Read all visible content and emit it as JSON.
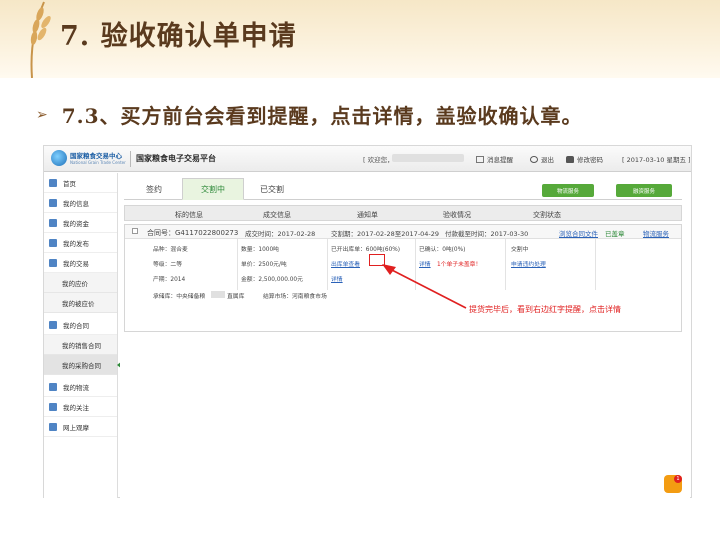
{
  "slide": {
    "title": "7. 验收确认单申请",
    "bullet": "➢",
    "subtitle": "7.3、买方前台会看到提醒，点击详情，盖验收确认章。"
  },
  "topbar": {
    "logo_main": "国家粮食交易中心",
    "logo_en": "National Grain Trade Center",
    "platform_title": "国家粮食电子交易平台",
    "welcome": "[ 欢迎您，",
    "message": "消息提醒",
    "logout": "退出",
    "change_password": "修改密码",
    "date": "[ 2017-03-10 星期五 ]"
  },
  "sidebar": {
    "items": [
      {
        "label": "首页",
        "icon": "home-icon"
      },
      {
        "label": "我的信息",
        "icon": "user-icon"
      },
      {
        "label": "我的资金",
        "icon": "money-icon"
      },
      {
        "label": "我的发布",
        "icon": "publish-icon"
      },
      {
        "label": "我的交易",
        "icon": "trade-icon"
      }
    ],
    "trade_subs": [
      "我的应价",
      "我的被应价"
    ],
    "contract": {
      "label": "我的合同",
      "icon": "contract-icon"
    },
    "contract_subs": [
      "我的销售合同",
      "我的采购合同"
    ],
    "bottom_items": [
      {
        "label": "我的物流",
        "icon": "truck-icon"
      },
      {
        "label": "我的关注",
        "icon": "heart-icon"
      },
      {
        "label": "网上观摩",
        "icon": "eye-icon"
      }
    ]
  },
  "tabs": [
    "签约",
    "交割中",
    "已交割"
  ],
  "buttons": {
    "logistics": "物流服务",
    "financial": "融资服务"
  },
  "grid_headers": [
    "标的信息",
    "成交信息",
    "通知单",
    "验收情况",
    "交割状态"
  ],
  "order": {
    "contract_no": "合同号：G4117022800273",
    "deal_time": "成交时间：2017-02-28",
    "delivery_time": "交割期：2017-02-28至2017-04-29",
    "payment_due": "付款截至时间：2017-03-30",
    "view_contract": "浏览合同文件",
    "stamped": "已盖章",
    "logistics_service": "物流服务",
    "variety": "品种：混合麦",
    "grade": "等级：二等",
    "origin": "产期：2014",
    "quantity": "数量：1000吨",
    "unit_price": "单价：2500元/吨",
    "amount": "金额：2,500,000.00元",
    "issued_out": "已开出库单：600吨(60%)",
    "out_notice": "出库单查看",
    "detail_link": "详情",
    "confirmed": "已确认：0吨(0%)",
    "detail": "详情",
    "unstamped": "1个单子未盖章！",
    "delivering": "交割中",
    "apply_cancel": "申请违约处理",
    "warehouse": "承储库：中央储备粮",
    "warehouse_tail": "直属库",
    "market": "结算市场：河南粮食市场"
  },
  "annotation": "提货完毕后，看到右边红字提醒，点击详情",
  "colors": {
    "accent_green": "#56a93a",
    "link_blue": "#2a62b8",
    "alert_red": "#e02020",
    "title_brown": "#5a3a1e"
  }
}
